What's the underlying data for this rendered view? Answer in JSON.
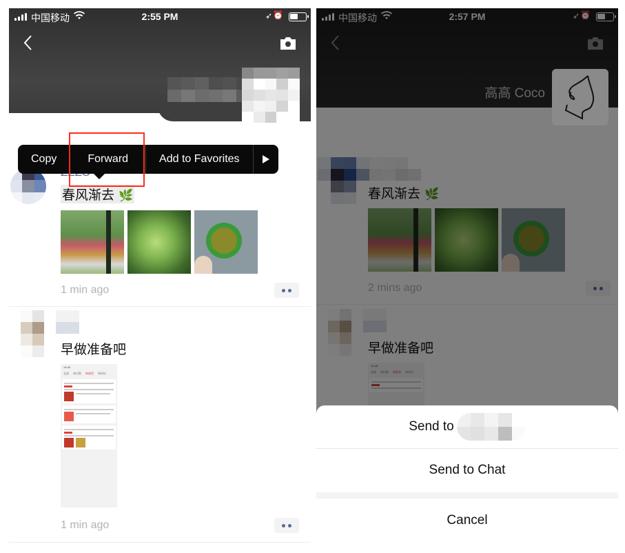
{
  "left": {
    "status_bar": {
      "carrier": "中国移动",
      "time": "2:55 PM",
      "wifi_icon": "wifi-icon",
      "location_icon": "location-arrow-icon",
      "alarm_icon": "alarm-icon",
      "battery_icon": "battery-icon"
    },
    "nav": {
      "back_icon": "chevron-left-icon",
      "camera_icon": "camera-icon"
    },
    "context_menu": {
      "items": [
        "Copy",
        "Forward",
        "Add to Favorites"
      ],
      "more_icon": "play-triangle-icon",
      "highlighted": "Forward"
    },
    "posts": [
      {
        "nickname": "ZZZS",
        "text": "春风渐去",
        "emoji": "🌿",
        "photos": [
          "park-bench-photo",
          "tree-canopy-photo",
          "green-tea-cup-photo"
        ],
        "timestamp": "1 min ago"
      },
      {
        "nickname": "",
        "text": "早做准备吧",
        "screenshot": {
          "time": "13:40",
          "tabs": [
            "全部",
            "待付款",
            "待收货",
            "待评价"
          ]
        },
        "timestamp": "1 min ago"
      }
    ],
    "highlight_color": "#ff2a1a"
  },
  "right": {
    "status_bar": {
      "carrier": "中国移动",
      "time": "2:57 PM"
    },
    "cover": {
      "name": "高高 Coco"
    },
    "posts": [
      {
        "text": "春风渐去",
        "emoji": "🌿",
        "timestamp": "2 mins ago"
      },
      {
        "text": "早做准备吧"
      }
    ],
    "action_sheet": {
      "send_to_label": "Send to",
      "send_to_chat": "Send to Chat",
      "cancel": "Cancel"
    }
  },
  "colors": {
    "link_blue": "#576b95",
    "timestamp_gray": "#b2b2b2"
  }
}
